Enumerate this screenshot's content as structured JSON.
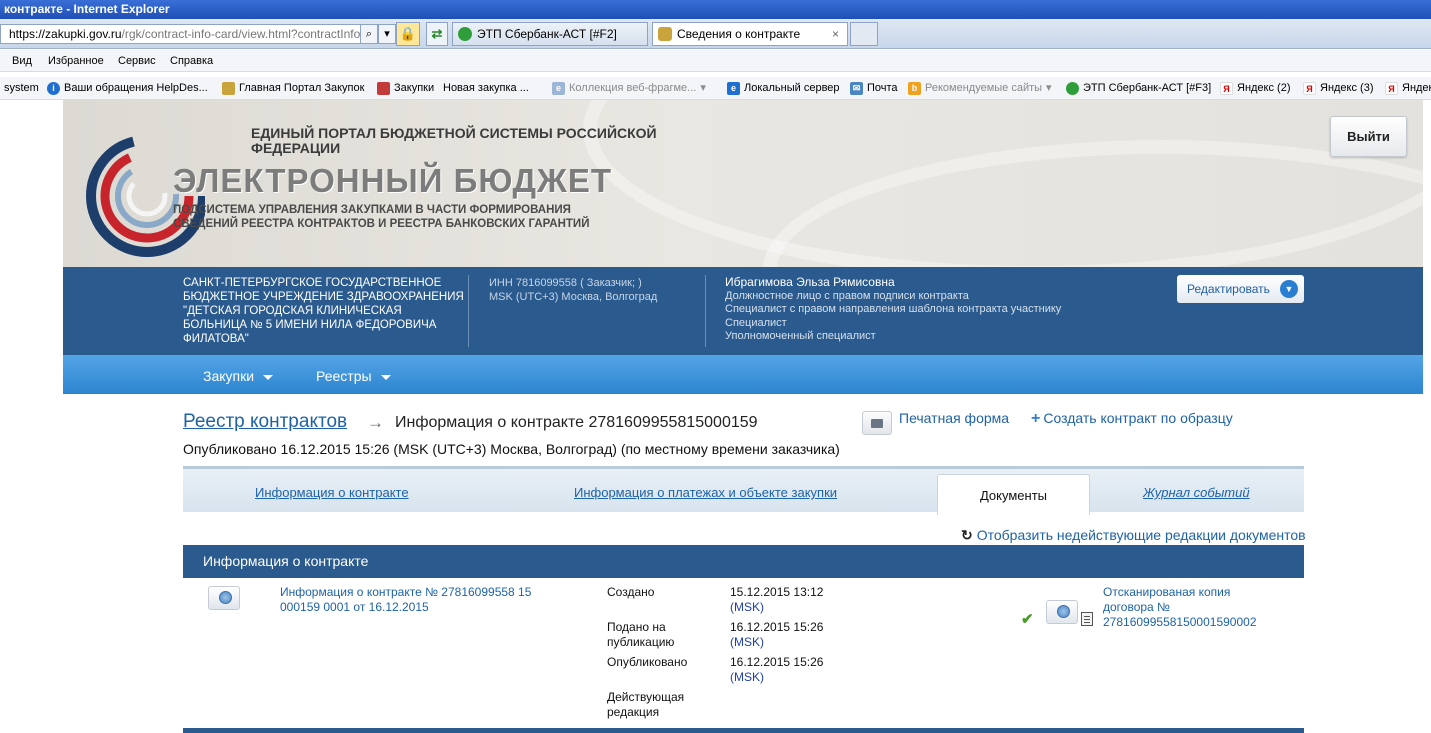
{
  "window": {
    "title": "контракте - Internet Explorer"
  },
  "browser": {
    "address_prefix": "https://zakupki.gov.ru",
    "address_rest": "/rgk/contract-info-card/view.html?contractInfoId=",
    "tabs": [
      {
        "label": "ЭТП Сбербанк-АСТ [#F2]"
      },
      {
        "label": "Сведения о контракте",
        "close": "×"
      }
    ]
  },
  "menu": {
    "items": [
      "Вид",
      "Избранное",
      "Сервис",
      "Справка"
    ]
  },
  "favorites": {
    "items": [
      "system",
      "Ваши обращения HelpDes...",
      "Главная Портал Закупок",
      "Закупки",
      "Новая закупка ...",
      "Коллекция веб-фрагме...",
      "Локальный сервер",
      "Почта",
      "Рекомендуемые сайты",
      "ЭТП Сбербанк-АСТ [#F3]",
      "Яндекс (2)",
      "Яндекс (3)",
      "Яндек"
    ]
  },
  "header": {
    "brand_top": "ЕДИНЫЙ ПОРТАЛ БЮДЖЕТНОЙ СИСТЕМЫ РОССИЙСКОЙ ФЕДЕРАЦИИ",
    "brand_main": "ЭЛЕКТРОННЫЙ БЮДЖЕТ",
    "brand_sub": "ПОДСИСТЕМА УПРАВЛЕНИЯ ЗАКУПКАМИ В ЧАСТИ ФОРМИРОВАНИЯ СВЕДЕНИЙ РЕЕСТРА КОНТРАКТОВ И РЕЕСТРА БАНКОВСКИХ ГАРАНТИЙ",
    "logout_label": "Выйти"
  },
  "org": {
    "name": "Санкт-Петербургское государственное бюджетное учреждение здравоохранения \"Детская городская клиническая больница № 5 имени Нила Федоровича Филатова\"",
    "inn": "ИНН 7816099558 ( Заказчик; )",
    "tz": "MSK (UTC+3) Москва, Волгоград",
    "user_name": "Ибрагимова Эльза Рямисовна",
    "roles": [
      "Должностное лицо с правом подписи контракта",
      "Специалист с правом направления шаблона контракта участнику",
      "Специалист",
      "Уполномоченный специалист"
    ],
    "edit_label": "Редактировать"
  },
  "nav": {
    "items": [
      "Закупки",
      "Реестры"
    ]
  },
  "breadcrumb": {
    "root": "Реестр контрактов",
    "arrow": "→",
    "current": "Информация о контракте 2781609955815000159"
  },
  "actions": {
    "print": "Печатная форма",
    "create": "Создать контракт по образцу"
  },
  "published": "Опубликовано 16.12.2015 15:26 (MSK (UTC+3) Москва, Волгоград) (по местному времени заказчика)",
  "page_tabs": {
    "info": "Информация о контракте",
    "payments": "Информация о платежах и объекте закупки",
    "documents": "Документы",
    "journal": "Журнал событий"
  },
  "show_inactive": "Отобразить недействующие редакции документов",
  "section": {
    "title": "Информация о контракте",
    "doc_link": "Информация о контракте № 27816099558 15 000159 0001 от 16.12.2015",
    "created_label": "Создано",
    "created_value": "15.12.2015 13:12",
    "submitted_label": "Подано на публикацию",
    "submitted_value": "16.12.2015 15:26",
    "published_label": "Опубликовано",
    "published_value": "16.12.2015 15:26",
    "tz_short": "(MSK)",
    "current_label": "Действующая редакция",
    "scan_link": "Отсканированая копия договора № 27816099558150001590002"
  }
}
